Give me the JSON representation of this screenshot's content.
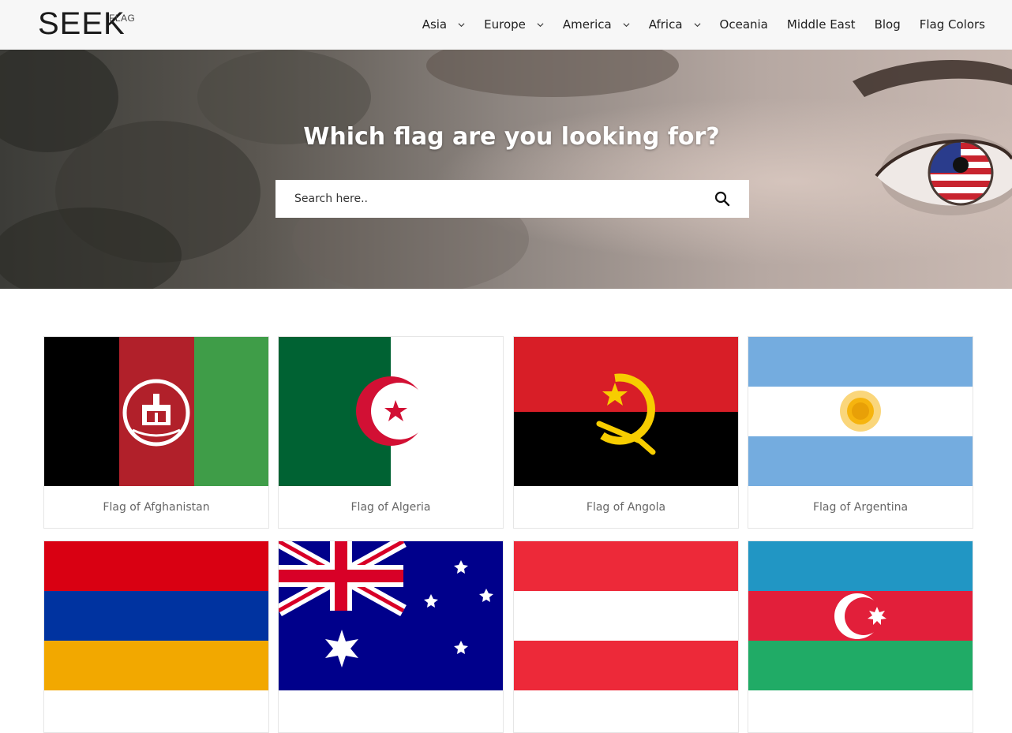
{
  "logo": {
    "main": "SEEK",
    "sup": "FLAG"
  },
  "nav": {
    "items": [
      {
        "label": "Asia",
        "dropdown": true
      },
      {
        "label": "Europe",
        "dropdown": true
      },
      {
        "label": "America",
        "dropdown": true
      },
      {
        "label": "Africa",
        "dropdown": true
      },
      {
        "label": "Oceania",
        "dropdown": false
      },
      {
        "label": "Middle East",
        "dropdown": false
      },
      {
        "label": "Blog",
        "dropdown": false
      },
      {
        "label": "Flag Colors",
        "dropdown": false
      }
    ]
  },
  "hero": {
    "title": "Which flag are you looking for?",
    "search_placeholder": "Search here.."
  },
  "flags": [
    {
      "caption": "Flag of Afghanistan",
      "icon": "afghanistan-flag"
    },
    {
      "caption": "Flag of Algeria",
      "icon": "algeria-flag"
    },
    {
      "caption": "Flag of Angola",
      "icon": "angola-flag"
    },
    {
      "caption": "Flag of Argentina",
      "icon": "argentina-flag"
    },
    {
      "caption": "",
      "icon": "armenia-flag"
    },
    {
      "caption": "",
      "icon": "australia-flag"
    },
    {
      "caption": "",
      "icon": "austria-flag"
    },
    {
      "caption": "",
      "icon": "azerbaijan-flag"
    }
  ],
  "colors": {
    "header_bg": "#f7f7f7",
    "text": "#1e1e1e",
    "caption": "#666666"
  }
}
